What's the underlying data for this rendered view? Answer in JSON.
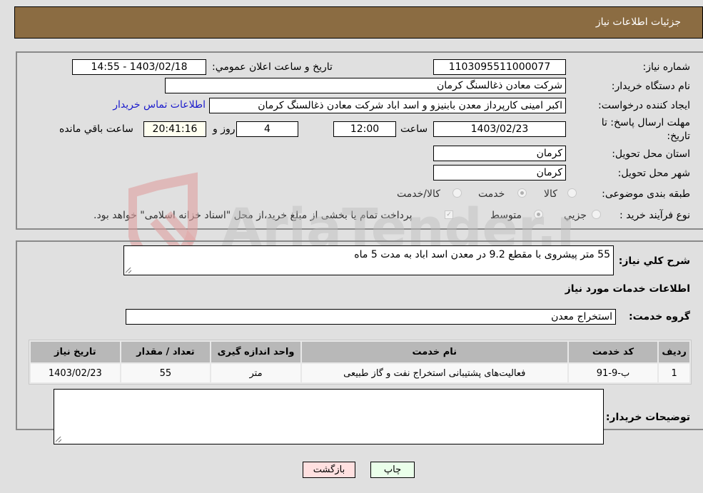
{
  "header": {
    "title": "جزئيات اطلاعات نياز"
  },
  "details": {
    "need_number_label": "شماره نياز:",
    "need_number": "1103095511000077",
    "announce_label": "تاريخ و ساعت اعلان عمومي:",
    "announce_value": "1403/02/18 - 14:55",
    "buyer_org_label": "نام دستگاه خريدار:",
    "buyer_org": "شرکت معادن ذغالسنگ کرمان",
    "creator_label": "ايجاد کننده درخواست:",
    "creator": "اکبر امینی کارپرداز معدن بابنیزو و اسد اباد شرکت معادن ذغالسنگ کرمان",
    "contact_link": "اطلاعات تماس خريدار",
    "deadline_label_line1": "مهلت ارسال پاسخ: تا",
    "deadline_label_line2": "تاريخ:",
    "deadline_date": "1403/02/23",
    "time_label": "ساعت",
    "deadline_time": "12:00",
    "days_value": "4",
    "days_label": "روز و",
    "remaining_time": "20:41:16",
    "remaining_label": "ساعت باقي مانده",
    "province_label": "استان محل تحويل:",
    "province": "کرمان",
    "city_label": "شهر محل تحويل:",
    "city": "کرمان",
    "category_label": "طبقه بندی موضوعی:",
    "category_options": [
      {
        "label": "کالا",
        "checked": false
      },
      {
        "label": "خدمت",
        "checked": true
      },
      {
        "label": "کالا/خدمت",
        "checked": false
      }
    ],
    "process_label": "نوع فرآيند خريد :",
    "process_options": [
      {
        "label": "جزيي",
        "checked": false
      },
      {
        "label": "متوسط",
        "checked": true
      }
    ],
    "treasury_checkbox_label": "پرداخت تمام يا بخشی از مبلغ خريد،از محل \"اسناد خزانه اسلامی\" خواهد بود.",
    "treasury_checked": true
  },
  "description": {
    "label": "شرح کلي نياز:",
    "value": "55 متر پیشروی با مقطع 9.2 در معدن اسد اباد به مدت 5 ماه"
  },
  "services": {
    "section_title": "اطلاعات خدمات مورد نياز",
    "group_label": "گروه خدمت:",
    "group_value": "استخراج معدن",
    "table": {
      "headers": [
        "رديف",
        "کد خدمت",
        "نام خدمت",
        "واحد اندازه گيری",
        "تعداد / مقدار",
        "تاريخ نياز"
      ],
      "rows": [
        [
          "1",
          "ب-9-91",
          "فعالیت‌های پشتیبانی استخراج نفت و گاز طبیعی",
          "متر",
          "55",
          "1403/02/23"
        ]
      ]
    }
  },
  "buyer_notes": {
    "label": "توضيحات خريدار:",
    "value": ""
  },
  "buttons": {
    "print": "چاپ",
    "back": "بازگشت"
  },
  "watermark": {
    "text": "AriaTender.neT"
  }
}
